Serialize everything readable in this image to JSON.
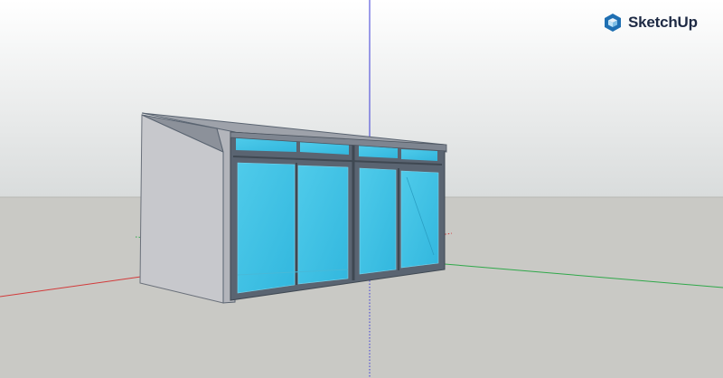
{
  "app": {
    "brand_name": "SketchUp",
    "brand_logo_icon": "sketchup-logo-icon"
  },
  "scene": {
    "model": "glass-enclosure-with-lean-to-roof",
    "colors": {
      "sky_top": "#ffffff",
      "sky_bottom": "#d9dcdc",
      "ground": "#c9c9c5",
      "horizon_line": "#b8b8b4",
      "axis_red": "#d23a3a",
      "axis_green": "#2fa84a",
      "axis_blue": "#3b3bd6",
      "wall_face": "#c7c8cc",
      "wall_front": "#b3b5bb",
      "roof": "#9ea2aa",
      "frame": "#5a6471",
      "glass": "#3cc4e8",
      "glass_light": "#7fd6ee",
      "brand_blue": "#1f6fb2"
    }
  }
}
